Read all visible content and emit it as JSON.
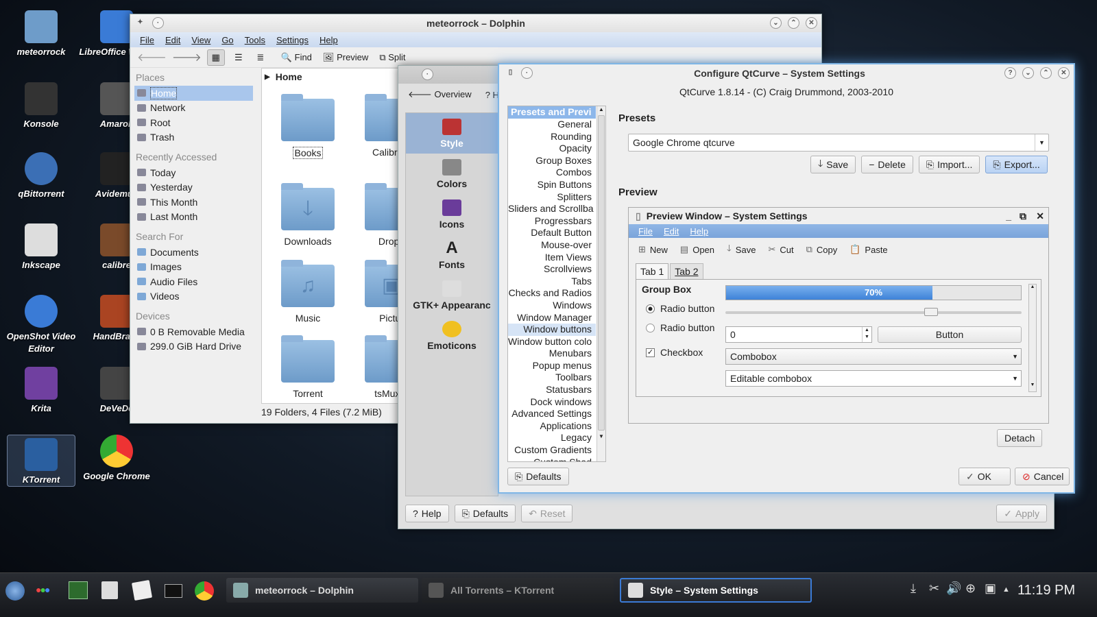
{
  "desktop_icons": [
    {
      "label": "meteorrock"
    },
    {
      "label": "LibreOffice Writer"
    },
    {
      "label": "Konsole"
    },
    {
      "label": "Amarok"
    },
    {
      "label": "qBittorrent"
    },
    {
      "label": "Avidemux"
    },
    {
      "label": "Inkscape"
    },
    {
      "label": "calibre"
    },
    {
      "label": "OpenShot Video Editor"
    },
    {
      "label": "HandBrake"
    },
    {
      "label": "Krita"
    },
    {
      "label": "DeVeDe"
    },
    {
      "label": "KTorrent"
    },
    {
      "label": "Google Chrome"
    }
  ],
  "dolphin": {
    "title": "meteorrock – Dolphin",
    "menu": [
      "File",
      "Edit",
      "View",
      "Go",
      "Tools",
      "Settings",
      "Help"
    ],
    "toolbar": {
      "find": "Find",
      "preview": "Preview",
      "split": "Split"
    },
    "places_head": "Places",
    "places": [
      "Home",
      "Network",
      "Root",
      "Trash"
    ],
    "recent_head": "Recently Accessed",
    "recent": [
      "Today",
      "Yesterday",
      "This Month",
      "Last Month"
    ],
    "search_head": "Search For",
    "search": [
      "Documents",
      "Images",
      "Audio Files",
      "Videos"
    ],
    "devices_head": "Devices",
    "devices": [
      "0 B Removable Media",
      "299.0 GiB Hard Drive"
    ],
    "breadcrumb": "Home",
    "files": [
      "Books",
      "Calibre L",
      "Downloads",
      "Dropb",
      "Music",
      "Pictur",
      "Torrent",
      "tsMuxer"
    ],
    "status": "19 Folders, 4 Files (7.2 MiB)"
  },
  "syssettings": {
    "overview": "Overview",
    "help_short": "He",
    "modules": [
      "Style",
      "Colors",
      "Icons",
      "Fonts",
      "GTK+ Appearanc",
      "Emoticons"
    ],
    "help": "Help",
    "defaults": "Defaults",
    "reset": "Reset",
    "apply": "Apply"
  },
  "qtcurve": {
    "title": "Configure QtCurve – System Settings",
    "subtitle": "QtCurve 1.8.14 - (C) Craig Drummond, 2003-2010",
    "cat_header": "Presets and Previ",
    "categories": [
      "General",
      "Rounding",
      "Opacity",
      "Group Boxes",
      "Combos",
      "Spin Buttons",
      "Splitters",
      "Sliders and Scrollba",
      "Progressbars",
      "Default Button",
      "Mouse-over",
      "Item Views",
      "Scrollviews",
      "Tabs",
      "Checks and Radios",
      "Windows",
      "Window Manager",
      "Window buttons",
      "Window button colo",
      "Menubars",
      "Popup menus",
      "Toolbars",
      "Statusbars",
      "Dock windows",
      "Advanced Settings",
      "Applications",
      "Legacy",
      "Custom Gradients",
      "Custom Shad"
    ],
    "selected_category": "Window buttons",
    "presets_label": "Presets",
    "preset_value": "Google Chrome qtcurve",
    "save": "Save",
    "delete": "Delete",
    "import": "Import...",
    "export": "Export...",
    "preview_label": "Preview",
    "preview_title": "Preview Window – System Settings",
    "preview_menu": [
      "File",
      "Edit",
      "Help"
    ],
    "preview_toolbar": [
      "New",
      "Open",
      "Save",
      "Cut",
      "Copy",
      "Paste"
    ],
    "tabs": [
      "Tab 1",
      "Tab 2"
    ],
    "group_box": "Group Box",
    "progress_text": "70%",
    "progress": 0.7,
    "radio1": "Radio button",
    "radio2": "Radio button",
    "spin_value": "0",
    "button": "Button",
    "checkbox": "Checkbox",
    "combobox": "Combobox",
    "editable_combobox": "Editable combobox",
    "detach": "Detach",
    "defaults": "Defaults",
    "ok": "OK",
    "cancel": "Cancel"
  },
  "taskbar": {
    "tasks": [
      "meteorrock – Dolphin",
      "All Torrents – KTorrent",
      "Style – System Settings"
    ],
    "clock": "11:19 PM"
  }
}
